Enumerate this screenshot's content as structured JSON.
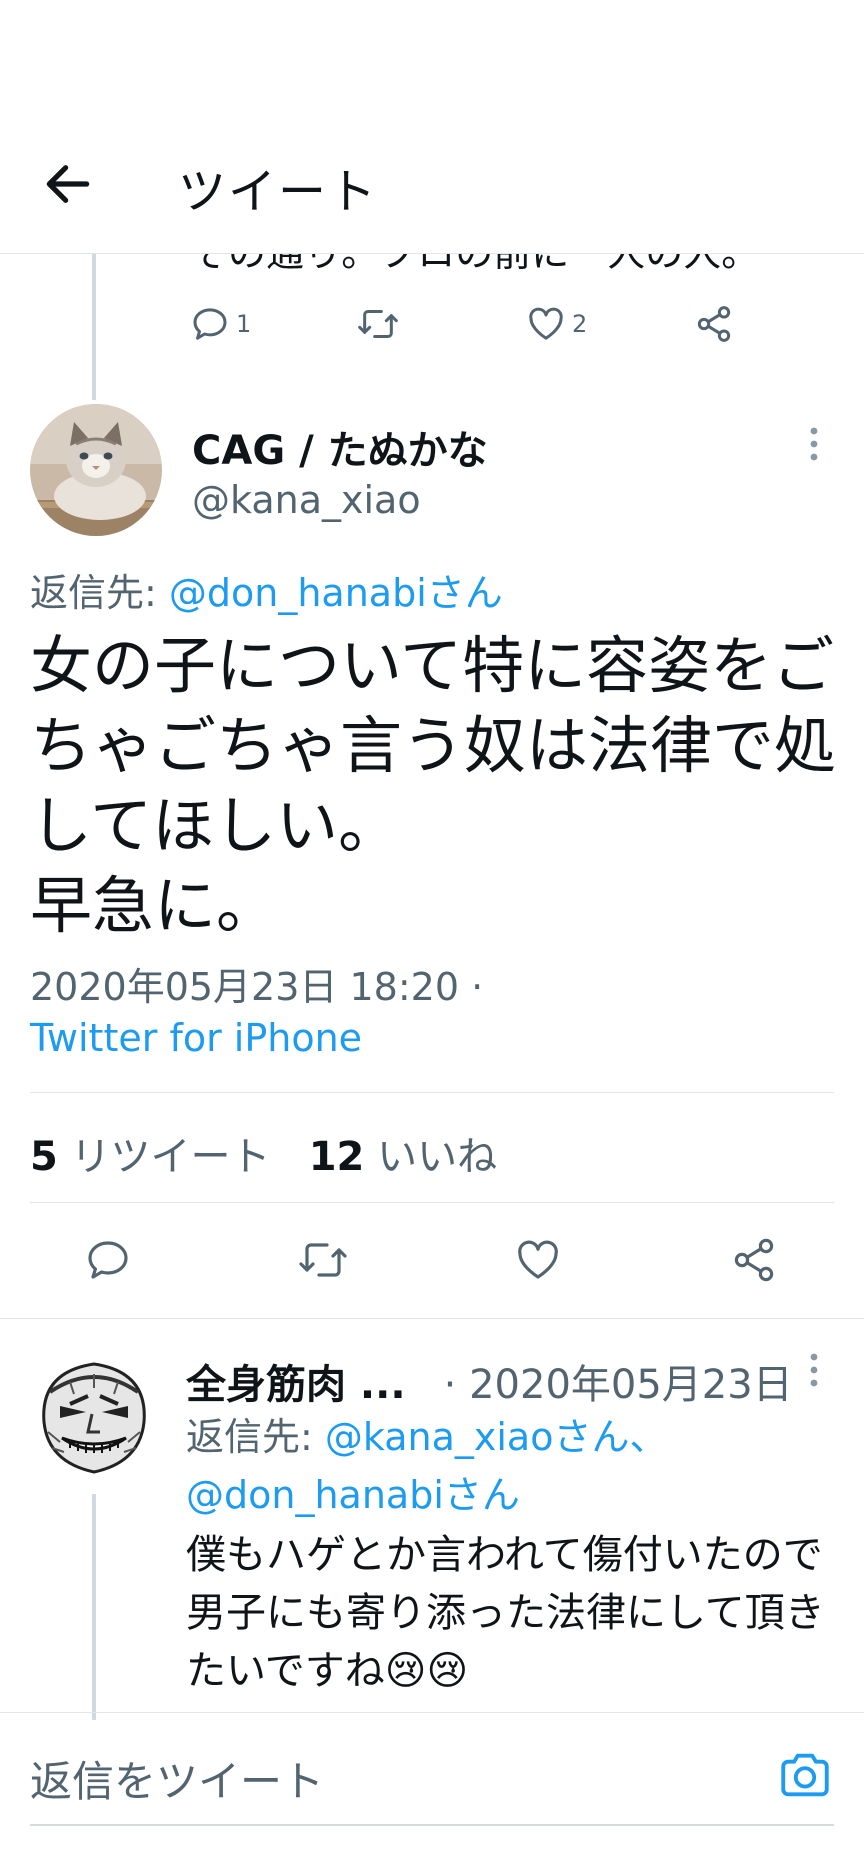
{
  "header": {
    "title": "ツイート"
  },
  "prev_tweet": {
    "text_fragment": "その通り。プロの前に一人の人。",
    "reply_count": "1",
    "like_count": "2"
  },
  "main_tweet": {
    "display_name": "CAG / たぬかな",
    "handle": "@kana_xiao",
    "reply_prefix": "返信先: ",
    "reply_to": "@don_hanabiさん",
    "text": "女の子について特に容姿をごちゃごちゃ言う奴は法律で処してほしい。\n早急に。",
    "timestamp": "2020年05月23日 18:20 ·",
    "source": "Twitter for iPhone",
    "retweet_count": "5",
    "retweet_label": "リツイート",
    "like_count": "12",
    "like_label": "いいね"
  },
  "reply_tweet": {
    "display_name": "全身筋肉 ...",
    "date": "· 2020年05月23日",
    "reply_prefix": "返信先: ",
    "reply_to_1": "@kana_xiaoさん、",
    "reply_to_2": "@don_hanabiさん",
    "text": "僕もハゲとか言われて傷付いたので男子にも寄り添った法律にして頂きたいですね😢😢"
  },
  "compose": {
    "placeholder": "返信をツイート"
  },
  "colors": {
    "accent": "#1d9bf0",
    "text_primary": "#0f1419",
    "text_secondary": "#536471",
    "divider": "#e3e6e8"
  },
  "icons": [
    "back-arrow-icon",
    "reply-icon",
    "retweet-icon",
    "like-icon",
    "share-icon",
    "more-icon",
    "camera-icon"
  ]
}
